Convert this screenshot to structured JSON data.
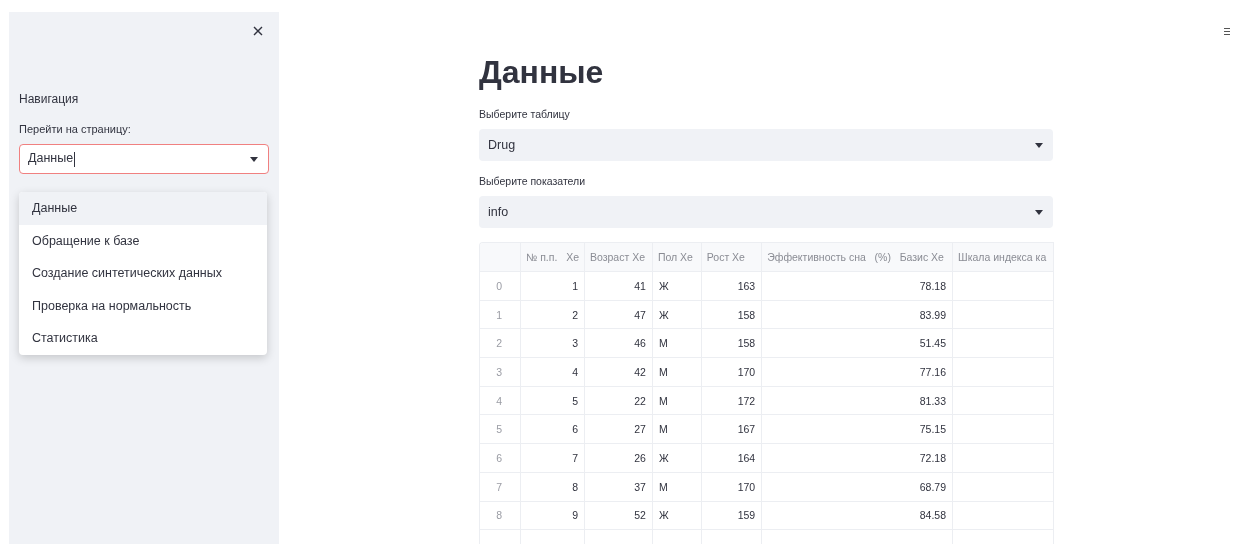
{
  "sidebar": {
    "heading": "Навигация",
    "page_select": {
      "label": "Перейти на страницу:",
      "value": "Данные",
      "focused": true,
      "expanded": true,
      "options": [
        {
          "label": "Данные",
          "selected": true
        },
        {
          "label": "Обращение к базе",
          "selected": false
        },
        {
          "label": "Создание синтетических данных",
          "selected": false
        },
        {
          "label": "Проверка на нормальность",
          "selected": false
        },
        {
          "label": "Статистика",
          "selected": false
        }
      ]
    }
  },
  "main": {
    "title": "Данные",
    "selects": [
      {
        "label": "Выберите таблицу",
        "value": "Drug"
      },
      {
        "label": "Выберите показатели",
        "value": "info"
      }
    ],
    "table": {
      "columns": [
        {
          "label": "№ п.п.   Xe",
          "kind": "number"
        },
        {
          "label": "Возраст Xe",
          "kind": "number"
        },
        {
          "label": "Пол Xe",
          "kind": "text"
        },
        {
          "label": "Рост Xe",
          "kind": "number"
        },
        {
          "label": "Эффективность сна   (%)   Базис Xe",
          "kind": "number"
        },
        {
          "label": "Шкала индекса ка",
          "kind": "text"
        }
      ],
      "rows": [
        {
          "index": "0",
          "cells": [
            "1",
            "41",
            "Ж",
            "163",
            "78.18"
          ]
        },
        {
          "index": "1",
          "cells": [
            "2",
            "47",
            "Ж",
            "158",
            "83.99"
          ]
        },
        {
          "index": "2",
          "cells": [
            "3",
            "46",
            "М",
            "158",
            "51.45"
          ]
        },
        {
          "index": "3",
          "cells": [
            "4",
            "42",
            "М",
            "170",
            "77.16"
          ]
        },
        {
          "index": "4",
          "cells": [
            "5",
            "22",
            "М",
            "172",
            "81.33"
          ]
        },
        {
          "index": "5",
          "cells": [
            "6",
            "27",
            "М",
            "167",
            "75.15"
          ]
        },
        {
          "index": "6",
          "cells": [
            "7",
            "26",
            "Ж",
            "164",
            "72.18"
          ]
        },
        {
          "index": "7",
          "cells": [
            "8",
            "37",
            "М",
            "170",
            "68.79"
          ]
        },
        {
          "index": "8",
          "cells": [
            "9",
            "52",
            "Ж",
            "159",
            "84.58"
          ]
        }
      ]
    }
  }
}
